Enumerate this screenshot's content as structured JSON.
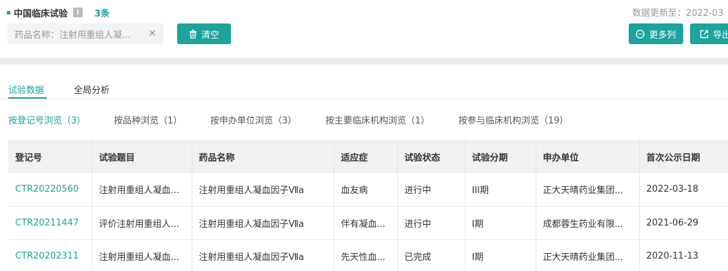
{
  "header": {
    "title": "中国临床试验",
    "info_icon": "info-icon",
    "count": "3条",
    "updated": "数据更新至：2022-03"
  },
  "filter": {
    "chip_text": "药品名称：注射用重组人凝...",
    "close_icon": "close-icon"
  },
  "buttons": {
    "clear": "清空",
    "more_columns": "更多列",
    "export": "导出"
  },
  "tabs": [
    {
      "label": "试验数据",
      "active": true
    },
    {
      "label": "全局分析",
      "active": false
    }
  ],
  "subtabs": [
    {
      "label": "按登记号浏览（3）",
      "active": true
    },
    {
      "label": "按品种浏览（1）",
      "active": false
    },
    {
      "label": "按申办单位浏览（3）",
      "active": false
    },
    {
      "label": "按主要临床机构浏览（1）",
      "active": false
    },
    {
      "label": "按参与临床机构浏览（19）",
      "active": false
    }
  ],
  "table": {
    "columns": [
      "登记号",
      "试验题目",
      "药品名称",
      "适应症",
      "试验状态",
      "试验分期",
      "申办单位",
      "首次公示日期"
    ],
    "rows": [
      [
        "CTR20220560",
        "注射用重组人凝血...",
        "注射用重组人凝血因子Ⅶa",
        "血友病",
        "进行中",
        "III期",
        "正大天晴药业集团...",
        "2022-03-18"
      ],
      [
        "CTR20211447",
        "评价注射用重组人...",
        "注射用重组人凝血因子Ⅶa",
        "伴有凝血...",
        "进行中",
        "I期",
        "成都蓉生药业有限...",
        "2021-06-29"
      ],
      [
        "CTR20202311",
        "注射用重组人凝血...",
        "注射用重组人凝血因子Ⅶa",
        "先天性血...",
        "已完成",
        "I期",
        "正大天晴药业集团...",
        "2020-11-13"
      ]
    ]
  },
  "colors": {
    "accent": "#1ba39c",
    "header_bg": "#f0f1f3"
  }
}
